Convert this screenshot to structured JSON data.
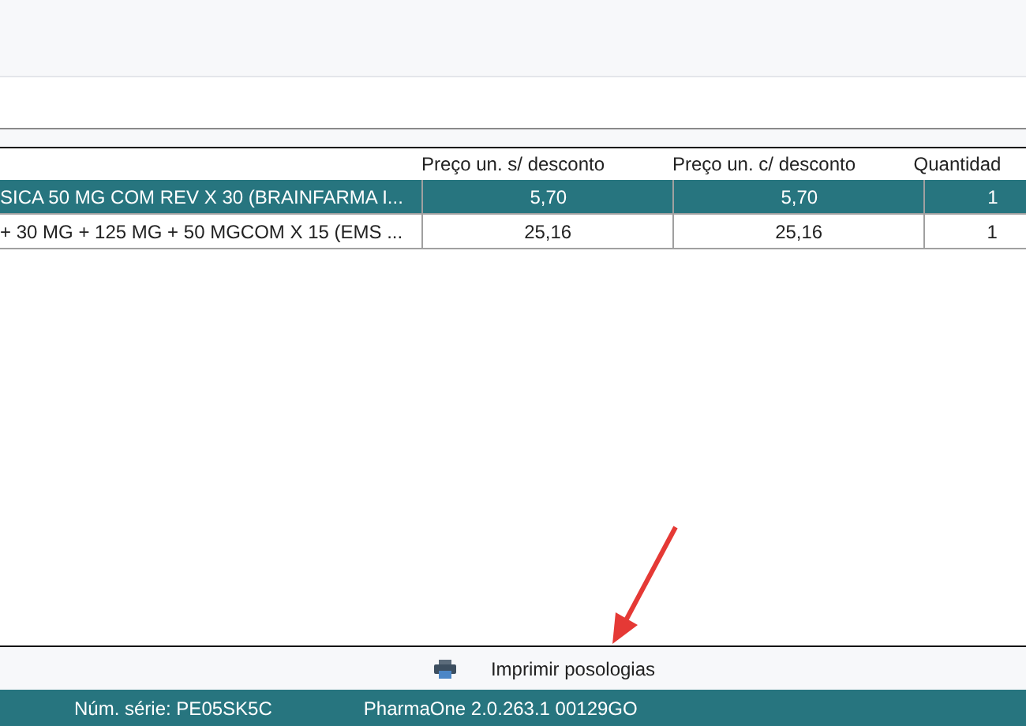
{
  "table": {
    "columns": [
      "",
      "Preço un. s/ desconto",
      "Preço un. c/ desconto",
      "Quantidad"
    ],
    "rows": [
      {
        "cells": [
          "SICA 50 MG COM REV X 30 (BRAINFARMA I...",
          "5,70",
          "5,70",
          "1"
        ],
        "selected": true
      },
      {
        "cells": [
          "+ 30 MG + 125 MG + 50 MGCOM X 15 (EMS ...",
          "25,16",
          "25,16",
          "1"
        ],
        "selected": false
      }
    ]
  },
  "toolbar": {
    "print_button": "Imprimir posologias"
  },
  "status_bar": {
    "serial": "Núm. série: PE05SK5C",
    "version": "PharmaOne 2.0.263.1 00129GO"
  }
}
